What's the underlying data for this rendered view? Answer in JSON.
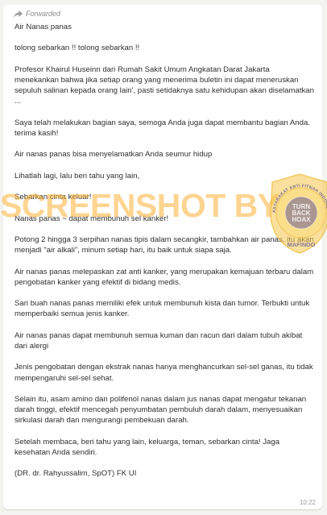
{
  "message": {
    "forwarded_label": "Forwarded",
    "forward_icon": "forward-arrow-icon",
    "time": "10:22",
    "paragraphs": [
      "Air Nanas panas",
      "tolong sebarkan !! tolong sebarkan !!",
      "Profesor Khairul Huseinn dari Rumah Sakit Umum Angkatan Darat Jakarta menekankan bahwa jika setiap orang yang menerima buletin ini dapat meneruskan sepuluh salinan kepada orang lain', pasti setidaknya satu kehidupan akan diselamatkan ...",
      "Saya telah melakukan bagian saya, semoga Anda juga dapat membantu bagian Anda. terima kasih!",
      "Air nanas panas bisa menyelamatkan Anda seumur hidup",
      "Lihatlah lagi, lalu beri tahu yang lain,",
      "Sebarkan cinta keluar!",
      "Nanas panas ~ dapat membunuh sel kanker!",
      "Potong 2 hingga 3 serpihan nanas tipis dalam secangkir, tambahkan air panas, itu akan menjadi \"air alkali\", minum setiap hari, itu baik untuk siapa saja.",
      "Air nanas panas melepaskan zat anti kanker, yang merupakan kemajuan terbaru dalam pengobatan kanker yang efektif di bidang medis.",
      "Sari buah nanas panas memiliki efek untuk membunuh kista dan tumor. Terbukti untuk memperbaiki semua jenis kanker.",
      "Air nanas panas dapat membunuh semua kuman dan racun dari dalam tubuh akibat dari alergi",
      "Jenis pengobatan dengan ekstrak nanas hanya menghancurkan sel-sel ganas, itu tidak mempengaruhi sel-sel sehat.",
      "Selain itu, asam amino dan polifenol nanas dalam jus nanas dapat mengatur tekanan darah tinggi, efektif mencegah penyumbatan pembuluh darah dalam, menyesuaikan sirkulasi darah dan mengurangi pembekuan darah.",
      "Setelah membaca, beri tahu yang lain, keluarga, teman, sebarkan cinta! Jaga kesehatan Anda sendiri.",
      "(DR. dr. Rahyussalim, SpOT) FK UI"
    ]
  },
  "watermark": {
    "text": "SCREENSHOT BY",
    "seal_top_text": "MASYARAKAT ANTI FITNAH INDONESIA",
    "seal_center_line1": "TURN",
    "seal_center_line2": "BACK",
    "seal_center_line3": "HOAX",
    "seal_bottom_text": "MAFINDO",
    "seal_color": "#f6c74a",
    "seal_inner_color": "#4a3f9a",
    "text_color": "#fbb034"
  }
}
